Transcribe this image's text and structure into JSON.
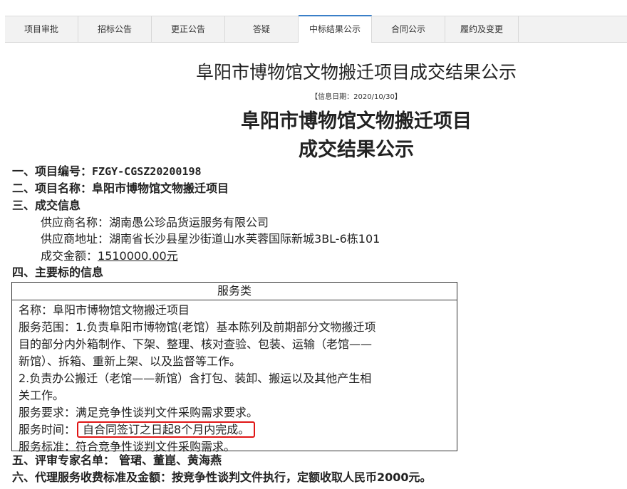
{
  "tabs": [
    {
      "label": "项目审批",
      "active": false
    },
    {
      "label": "招标公告",
      "active": false
    },
    {
      "label": "更正公告",
      "active": false
    },
    {
      "label": "答疑",
      "active": false
    },
    {
      "label": "中标结果公示",
      "active": true
    },
    {
      "label": "合同公示",
      "active": false
    },
    {
      "label": "履约及变更",
      "active": false
    }
  ],
  "page_title": "阜阳市博物馆文物搬迁项目成交结果公示",
  "info_date": "【信息日期：2020/10/30】",
  "doc_title_line1": "阜阳市博物馆文物搬迁项目",
  "doc_title_line2": "成交结果公示",
  "sections": {
    "s1_label": "一、项目编号：",
    "s1_value": "FZGY-CGSZ20200198",
    "s2_label": "二、项目名称：",
    "s2_value": "阜阳市博物馆文物搬迁项目",
    "s3_label": "三、成交信息",
    "supplier_name_label": "供应商名称：",
    "supplier_name": "湖南愚公珍品货运服务有限公司",
    "supplier_addr_label": "供应商地址：",
    "supplier_addr": "湖南省长沙县星沙街道山水芙蓉国际新城3BL-6栋101",
    "amount_label": "成交金额：",
    "amount": "1510000.00元",
    "s4_label": "四、主要标的信息",
    "s5_label": "五、评审专家名单：",
    "s5_value": "管珺、董崑、黄海燕",
    "s6_label": "六、代理服务收费标准及金额：",
    "s6_value": "按竞争性谈判文件执行，定额收取人民币2000元。"
  },
  "service_table": {
    "header": "服务类",
    "name": "名称：阜阳市博物馆文物搬迁项目",
    "scope_1a": "服务范围：1.负责阜阳市博物馆(老馆）基本陈列及前期部分文物搬迁项",
    "scope_1b": "目的部分内外箱制作、下架、整理、核对查验、包装、运输（老馆——",
    "scope_1c": "新馆）、拆箱、重新上架、以及监督等工作。",
    "scope_2a": "2.负责办公搬迁（老馆——新馆）含打包、装卸、搬运以及其他产生相",
    "scope_2b": "关工作。",
    "requirement": "服务要求：满足竞争性谈判文件采购需求要求。",
    "time_label": "服务时间：",
    "time_value": "自合同签订之日起8个月内完成。",
    "standard": "服务标准：符合竞争性谈判文件采购需求。"
  },
  "colors": {
    "highlight_border": "#e01515",
    "active_tab_accent": "#3a7fc8"
  }
}
